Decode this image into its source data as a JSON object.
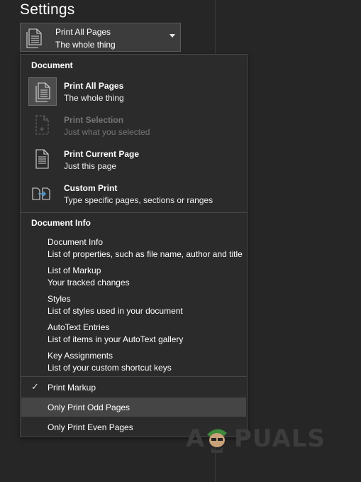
{
  "settings": {
    "title": "Settings"
  },
  "selector": {
    "title": "Print All Pages",
    "subtitle": "The whole thing"
  },
  "menu": {
    "document_header": "Document",
    "document_items": [
      {
        "title": "Print All Pages",
        "subtitle": "The whole thing",
        "icon": "page-icon",
        "selected": true
      },
      {
        "title": "Print Selection",
        "subtitle": "Just what you selected",
        "icon": "selection-icon",
        "disabled": true
      },
      {
        "title": "Print Current Page",
        "subtitle": "Just this page",
        "icon": "page-icon"
      },
      {
        "title": "Custom Print",
        "subtitle": "Type specific pages, sections or ranges",
        "icon": "custom-print-icon"
      }
    ],
    "info_header": "Document Info",
    "info_items": [
      {
        "title": "Document Info",
        "subtitle": "List of properties, such as file name, author and title"
      },
      {
        "title": "List of Markup",
        "subtitle": "Your tracked changes"
      },
      {
        "title": "Styles",
        "subtitle": "List of styles used in your document"
      },
      {
        "title": "AutoText Entries",
        "subtitle": "List of items in your AutoText gallery"
      },
      {
        "title": "Key Assignments",
        "subtitle": "List of your custom shortcut keys"
      }
    ],
    "options": [
      {
        "label": "Print Markup",
        "checked": true
      },
      {
        "label": "Only Print Odd Pages",
        "hovered": true
      },
      {
        "label": "Only Print Even Pages"
      }
    ]
  },
  "watermark": {
    "text_left": "A",
    "text_right": "PUALS"
  },
  "colors": {
    "background": "#262626",
    "menu": "#2b2b2b",
    "hover": "#454545",
    "disabled": "#767676"
  }
}
